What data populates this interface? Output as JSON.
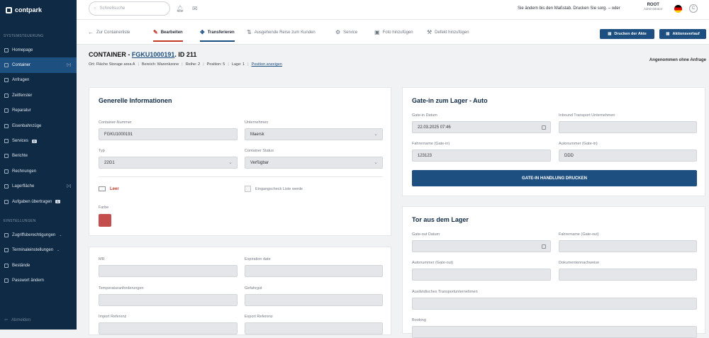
{
  "app": {
    "brand": "contpark"
  },
  "sidebar": {
    "section1": "SYSTEMSTEUERUNG",
    "items": [
      {
        "label": "Homepage"
      },
      {
        "label": "Container",
        "extra": "[+]"
      },
      {
        "label": "Anfragen"
      },
      {
        "label": "Zeitfenster"
      },
      {
        "label": "Reparatur"
      },
      {
        "label": "Eisenbahnzüge"
      },
      {
        "label": "Services",
        "badge": "0"
      },
      {
        "label": "Berichte"
      },
      {
        "label": "Rechnungen"
      },
      {
        "label": "Lagerfläche",
        "extra": "[+]"
      },
      {
        "label": "Aufgaben übertragen",
        "badge": "1"
      }
    ],
    "section2": "EINSTELLUNGEN",
    "items2": [
      {
        "label": "Zugriffsberechtigungen",
        "caret": "⌄"
      },
      {
        "label": "Terminaleinstellungen",
        "caret": "⌄"
      },
      {
        "label": "Bestände"
      },
      {
        "label": "Passwort ändern"
      }
    ],
    "logout": "Abmelden"
  },
  "topbar": {
    "search_placeholder": "Schnellsuche",
    "message": "Sie ändern bis den Maßstab. Drucken Sie sorg. – oder",
    "user_name": "ROOT",
    "user_role": "Administrator"
  },
  "actions": {
    "back": "Zur Containerliste",
    "edit": "Bearbeiten",
    "transfer": "Transferieren",
    "outgoing": "Ausgehende Reise zum Kunden",
    "services": "Service",
    "photo": "Foto hinzufügen",
    "defect": "Defekt hinzufügen",
    "print_file": "Drucken der Akte",
    "history": "Aktionsverlauf"
  },
  "container": {
    "prefix": "CONTAINER - ",
    "id": "FGKU1000191",
    "suffix": ". ID 211",
    "meta": {
      "ort": "Ort: Fläche Storage area A",
      "bereich": "Bereich: Warenkzone",
      "reihe": "Reihe: 2",
      "position": "Position: 5",
      "lage": "Lage: 1",
      "link": "Position anzeigen"
    },
    "status": "Angenommen ohne Anfrage"
  },
  "general": {
    "title": "Generelle Informationen",
    "number_label": "Container-Nummer",
    "number_value": "FGKU1000191",
    "company_label": "Unternehmen",
    "company_value": "Maersk",
    "type_label": "Typ",
    "type_value": "22G1",
    "status_label": "Container Status",
    "status_value": "Verfügbar",
    "empty_label": "Leer",
    "check_label": "Eingangscheck Liste werde",
    "color_label": "Farbe",
    "color_hex": "#c44d4d"
  },
  "extra": {
    "mrn_label": "MR",
    "expiry_label": "Expiration date",
    "temp_label": "Temperaturanforderungen",
    "cargo_label": "Gefahrgut",
    "import_label": "Import Referenz",
    "export_label": "Export Referenz"
  },
  "gatein": {
    "title": "Gate-in zum Lager - Auto",
    "date_label": "Gate-in Datum",
    "date_value": "22.03.2025 07:46",
    "transport_label": "Inbound Transport Unternehmen",
    "driver_label": "Fahrername (Gate-in)",
    "driver_value": "123123",
    "plate_label": "Autonummer (Gate-in)",
    "plate_value": "DDD",
    "button": "GATE-IN HANDLUNG DRUCKEN"
  },
  "gateout": {
    "title": "Tor aus dem Lager",
    "date_label": "Gate-out Datum",
    "driver_label": "Fahrername (Gate-out)",
    "plate_label": "Autonummer (Gate-out)",
    "doc_label": "Dokumentennachweise",
    "ext_transport_label": "Ausländisches Transportunternehmen",
    "booking_label": "Booking"
  }
}
